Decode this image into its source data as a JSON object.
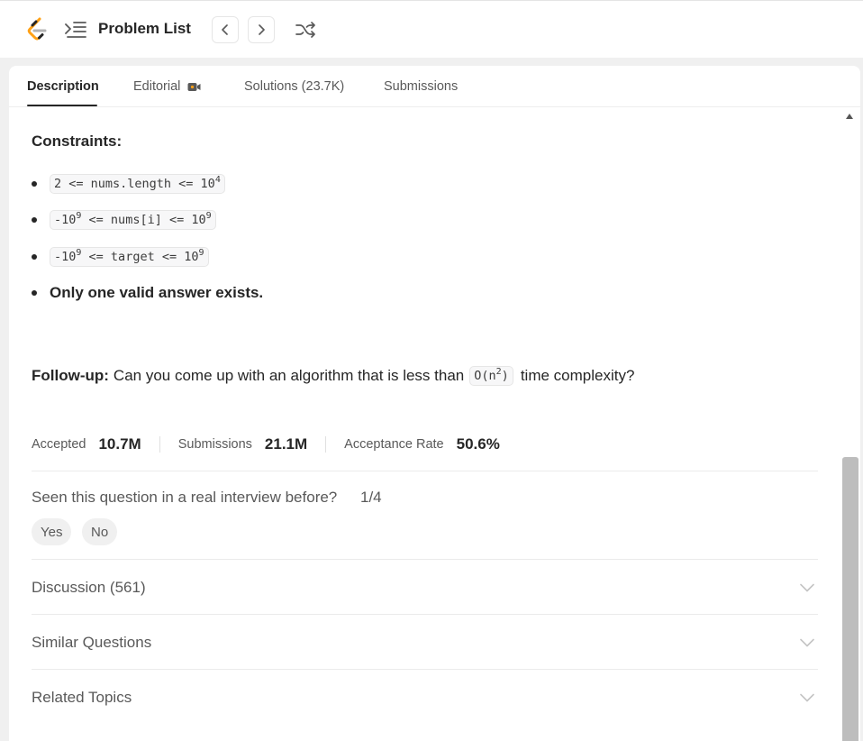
{
  "header": {
    "problem_list_label": "Problem List"
  },
  "tabs": [
    {
      "label": "Description"
    },
    {
      "label": "Editorial"
    },
    {
      "label": "Solutions (23.7K)"
    },
    {
      "label": "Submissions"
    }
  ],
  "constraints": {
    "title": "Constraints:",
    "items": [
      {
        "code": "2 <= nums.length <= 10",
        "sup": "4"
      },
      {
        "code_pre": "-10",
        "sup1": "9",
        "code_mid": " <= nums[i] <= 10",
        "sup2": "9"
      },
      {
        "code_pre": "-10",
        "sup1": "9",
        "code_mid": " <= target <= 10",
        "sup2": "9"
      }
    ],
    "unique": "Only one valid answer exists."
  },
  "followup": {
    "label": "Follow-up:",
    "text_before": "Can you come up with an algorithm that is less than",
    "code_pre": "O(n",
    "code_sup": "2",
    "code_post": ")",
    "text_after": "time complexity?"
  },
  "stats": {
    "accepted_label": "Accepted",
    "accepted_value": "10.7M",
    "submissions_label": "Submissions",
    "submissions_value": "21.1M",
    "rate_label": "Acceptance Rate",
    "rate_value": "50.6%"
  },
  "interview": {
    "question": "Seen this question in a real interview before?",
    "fraction": "1/4",
    "yes": "Yes",
    "no": "No"
  },
  "sections": [
    {
      "label": "Discussion (561)"
    },
    {
      "label": "Similar Questions"
    },
    {
      "label": "Related Topics"
    }
  ],
  "colors": {
    "logo_orange": "#ffa116",
    "logo_dark": "#262626",
    "logo_gray": "#b3b3b3"
  }
}
